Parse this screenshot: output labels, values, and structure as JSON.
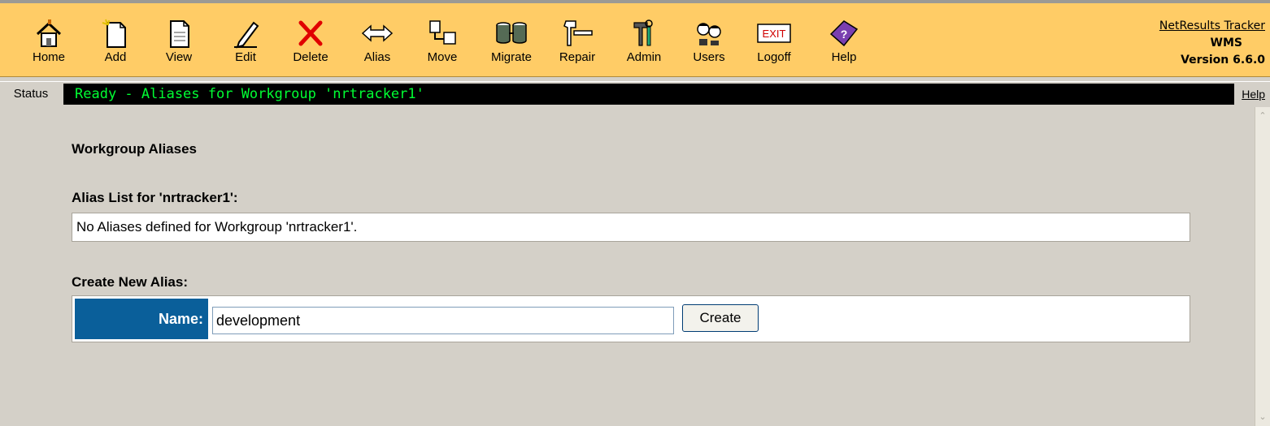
{
  "toolbar": {
    "buttons": [
      {
        "label": "Home"
      },
      {
        "label": "Add"
      },
      {
        "label": "View"
      },
      {
        "label": "Edit"
      },
      {
        "label": "Delete"
      },
      {
        "label": "Alias"
      },
      {
        "label": "Move"
      },
      {
        "label": "Migrate"
      },
      {
        "label": "Repair"
      },
      {
        "label": "Admin"
      },
      {
        "label": "Users"
      },
      {
        "label": "Logoff"
      },
      {
        "label": "Help"
      }
    ],
    "logoff_icon_text": "EXIT"
  },
  "brand": {
    "name": "NetResults Tracker",
    "product": "WMS",
    "version": "Version 6.6.0"
  },
  "status": {
    "label": "Status",
    "text": "Ready - Aliases for Workgroup 'nrtracker1'",
    "help": "Help"
  },
  "main": {
    "title": "Workgroup Aliases",
    "alias_list_heading": "Alias List for 'nrtracker1':",
    "alias_list_message": "No Aliases defined for Workgroup 'nrtracker1'.",
    "create_heading": "Create New Alias:",
    "name_label": "Name:",
    "name_value": "development",
    "create_button": "Create"
  },
  "colors": {
    "toolbar_bg": "#ffcc66",
    "status_bg": "#000000",
    "status_text": "#00ff33",
    "name_cell_bg": "#0a5f9a",
    "page_bg": "#d4d0c8"
  }
}
